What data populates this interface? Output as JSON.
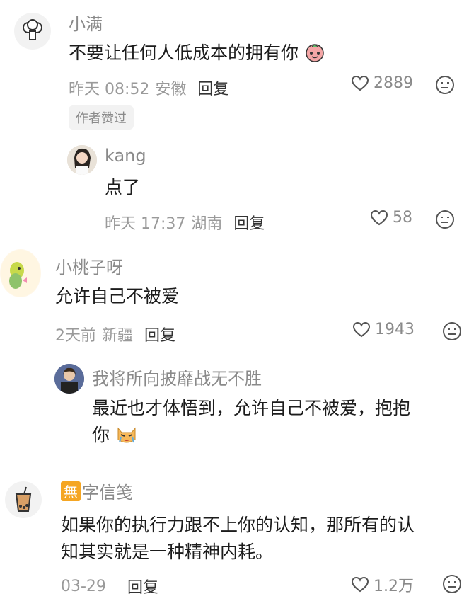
{
  "comments": [
    {
      "name": "小满",
      "content": "不要让任何人低成本的拥有你",
      "time": "昨天 08:52",
      "location": "安徽",
      "reply_label": "回复",
      "likes": "2889",
      "author_badge": "作者赞过",
      "avatar_icon": "broccoli-icon",
      "content_emoji": "peach-emoji-icon",
      "replies": [
        {
          "name": "kang",
          "content": "点了",
          "time": "昨天 17:37",
          "location": "湖南",
          "reply_label": "回复",
          "likes": "58",
          "avatar_icon": "girl-photo-avatar"
        }
      ]
    },
    {
      "name": "小桃子呀",
      "content": "允许自己不被爱",
      "time": "2天前",
      "location": "新疆",
      "reply_label": "回复",
      "likes": "1943",
      "avatar_icon": "cartoon-dino-avatar",
      "replies": [
        {
          "name": "我将所向披靡战无不胜",
          "content_line1": "最近也才体悟到，允许自己不被爱，抱抱",
          "content_line2": "你",
          "avatar_icon": "person-photo-avatar",
          "content_emoji": "crying-cat-emoji-icon"
        }
      ]
    },
    {
      "name_prefix": "無",
      "name": "字信笺",
      "content_line1": "如果你的执行力跟不上你的认知，那所有的认",
      "content_line2": "知其实就是一种精神内耗。",
      "time": "03-29",
      "reply_label": "回复",
      "likes": "1.2万",
      "avatar_icon": "bubble-tea-avatar"
    }
  ],
  "colors": {
    "accent_badge": "#f5a623",
    "meta_gray": "#9a9a9a"
  }
}
